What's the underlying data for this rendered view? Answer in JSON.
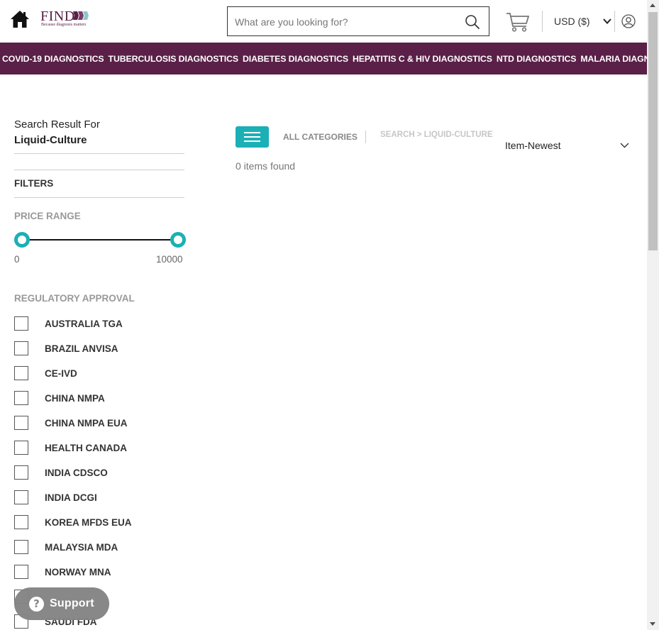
{
  "header": {
    "logo_text": "FIND",
    "logo_tagline": "Because diagnosis matters",
    "search_placeholder": "What are you looking for?",
    "search_value": "",
    "currency_label": "USD ($)",
    "colors": {
      "brand": "#5a2048",
      "accent": "#1ab0b6"
    }
  },
  "nav": {
    "items": [
      "COVID-19 DIAGNOSTICS",
      "TUBERCULOSIS DIAGNOSTICS",
      "DIABETES DIAGNOSTICS",
      "HEPATITIS C & HIV DIAGNOSTICS",
      "NTD DIAGNOSTICS",
      "MALARIA DIAGNOSTICS"
    ]
  },
  "sidebar": {
    "search_result_for": "Search Result For",
    "search_term": "Liquid-Culture",
    "filters_title": "FILTERS",
    "price_range_title": "PRICE RANGE",
    "price_min": "0",
    "price_max": "10000",
    "regulatory_title": "REGULATORY APPROVAL",
    "regulatory_options": [
      "AUSTRALIA TGA",
      "BRAZIL ANVISA",
      "CE-IVD",
      "CHINA NMPA",
      "CHINA NMPA EUA",
      "HEALTH CANADA",
      "INDIA CDSCO",
      "INDIA DCGI",
      "KOREA MFDS EUA",
      "MALAYSIA MDA",
      "NORWAY MNA",
      "",
      "SAUDI FDA"
    ]
  },
  "main": {
    "all_categories": "ALL CATEGORIES",
    "breadcrumb": "SEARCH > LIQUID-CULTURE",
    "sort_label": "Item-Newest",
    "items_found": "0 items found"
  },
  "support": {
    "label": "Support",
    "icon_glyph": "?"
  }
}
